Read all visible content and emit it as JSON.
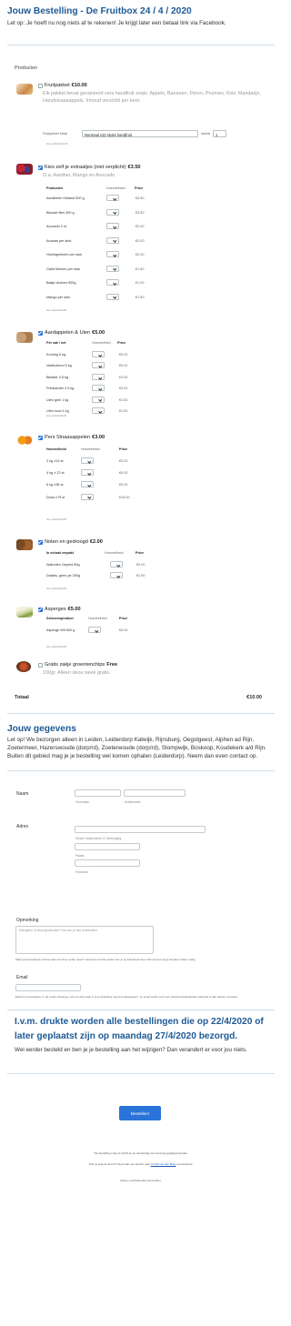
{
  "header": {
    "title": "Jouw Bestelling - De Fruitbox 24 / 4 / 2020",
    "intro": "Let op: Je hoeft nu nog niets af te rekenen! Je krijgt later een betaal link via Facebook."
  },
  "products_label": "Producten",
  "fruitpakket": {
    "name": "Fruitpakket",
    "price": "€10.00",
    "desc": "Elk pakket bevat gevarieerd vers handfruit zoals: Appels, Bananen, Peren, Pruimen, Kiwi, Mandarijn, Handsinaasappels. Inhoud verschilt per keer.",
    "size_label": "Fruitpakket Maat",
    "size_value": "Normaal x22 stuks handfruit",
    "qty_label": "Aantal",
    "qty_value": "1",
    "subtotal": "Item subtotal:€10.00"
  },
  "extraatjes": {
    "name": "Kies zelf je extraatjes (niet verplicht)",
    "price": "€3.50",
    "desc": "O.a. Aardbei, Mango en Avocado",
    "headers": [
      "Producten",
      "Hoeveelheid",
      "Price"
    ],
    "rows": [
      {
        "name": "Aardbeien Holland 500 g",
        "price": "€3.50"
      },
      {
        "name": "Blauwe Bes 300 g",
        "price": "€3.50"
      },
      {
        "name": "Avocado 2 st",
        "price": "€2.00"
      },
      {
        "name": "Ananas per stuk",
        "price": "€2.00"
      },
      {
        "name": "Honingmeloen per stuk",
        "price": "€2.00"
      },
      {
        "name": "Galia Meloen per stuk",
        "price": "€1.50"
      },
      {
        "name": "Bakje druiven 500g",
        "price": "€1.00"
      },
      {
        "name": "Mango per stuk",
        "price": "€1.50"
      }
    ],
    "subtotal": "Item subtotal:€0.00"
  },
  "aardappelen": {
    "name": "Aardappelen & Uien",
    "price": "€5.00",
    "headers": [
      "Per zak / net",
      "Hoeveelheid",
      "Price"
    ],
    "rows": [
      {
        "name": "Kruimig 5 kg",
        "price": "€5.00"
      },
      {
        "name": "Vastkokend 5 kg",
        "price": "€5.00"
      },
      {
        "name": "Bildstar 2.5 kg",
        "price": "€3.00"
      },
      {
        "name": "Frieslander 2.5 kg",
        "price": "€3.00"
      },
      {
        "name": "Uien geel 1 kg",
        "price": "€1.50"
      },
      {
        "name": "Uien rood 1 kg",
        "price": "€1.50"
      }
    ],
    "subtotal": "Item subtotal:€0.00"
  },
  "sinaasappelen": {
    "name": "Pers Sinaasappelen",
    "price": "€3.00",
    "headers": [
      "Hoeveelheid",
      "Hoeveelheid",
      "Price"
    ],
    "rows": [
      {
        "name": "2 kg ±13 st",
        "price": "€3.00"
      },
      {
        "name": "4 kg ± 22 st",
        "price": "€6.00"
      },
      {
        "name": "6 kg ±35 st",
        "price": "€9.00"
      },
      {
        "name": "Doos ±75 st",
        "price": "€18.00"
      }
    ],
    "subtotal": "Item subtotal:€0.00"
  },
  "noten": {
    "name": "Noten en gedroogd",
    "price": "€2.00",
    "headers": [
      "In schaal verpakt",
      "Hoeveelheid",
      "Price"
    ],
    "rows": [
      {
        "name": "Walnoten Gepeld 80g",
        "price": "€2.00"
      },
      {
        "name": "Dadels, geen pit 250g",
        "price": "€2.50"
      }
    ],
    "subtotal": "Item subtotal:€0.00"
  },
  "asperges": {
    "name": "Asperges",
    "price": "€5.00",
    "headers": [
      "Seizoensproduct",
      "Hoeveelheid",
      "Price"
    ],
    "rows": [
      {
        "name": "Asperge Wit 500 g",
        "price": "€5.00"
      }
    ],
    "subtotal": "Item subtotal:€0.00"
  },
  "groentenchips": {
    "name": "Gratis zakje groentenchips",
    "price": "Free",
    "desc": "100gr. Alleen deze week gratis."
  },
  "total": {
    "label": "Totaal",
    "value": "€10.00"
  },
  "gegevens": {
    "title": "Jouw gegevens",
    "intro": "Let op! We bezorgen alleen in Leiden, Leiderdorp Katwijk, Rijnsburg, Oegstgeest, Alphen ad Rijn, Zoetermeer, Hazerswoude (dorp/rd), Zoeterwoude (dorp/rd), Stompwijk, Boskoop, Koudekerk a/d Rijn. Buiten dit gebied mag je je bestelling wel komen ophalen (Leiderdorp). Neem dan even contact op."
  },
  "form": {
    "naam_label": "Naam",
    "voornaam": "Voornaam",
    "achternaam": "Achternaam",
    "adres_label": "Adres",
    "straat": "Straat, Huisnummer & Toevoeging",
    "plaats": "Plaats",
    "postcode": "Postcode",
    "opmerking_label": "Opmerking",
    "opmerking_placeholder": "Allergieën of bezorginstructie? Die kun je hier achterlaten.",
    "opmerking_help": "Wijkt jouw Facebook schermnaam af van je echte naam? Laat dan ook hier weten hoe je op Facebook heet. Dan kunnen wij je bereiken indien nodig.",
    "email_label": "Email",
    "email_help": "Enkel ter bevestiging. In de email ontvang je ook een link waar in je je bestelling nog kunt aanpassen*. Je email wordt nooit voor advertentiedoeleinden gebruikt of aan derden verstrekt."
  },
  "notice": {
    "title": "I.v.m. drukte worden alle bestellingen die op 22/4/2020 of later geplaatst zijn op maandag 27/4/2020 bezorgd.",
    "text": "Wel eerder besteld en ben je je bestelling aan het wijzigen? Dan verandert er voor jou niets."
  },
  "submit_label": "Bestellen!",
  "footer": {
    "line1": "*De bestelling mag tot 12.00 op de donderdag voor levering gewijzigd worden.",
    "line2_pre": "Kom je ergens niet uit? Stuur dan een bericht naar ",
    "line2_link": "Yorrick van den Burg",
    "line2_post": " op Facebook.",
    "line3": "Prijzen voorbehouden aan fouten."
  },
  "colors": {
    "accent": "#1e5a96",
    "button": "#2a73d9"
  }
}
